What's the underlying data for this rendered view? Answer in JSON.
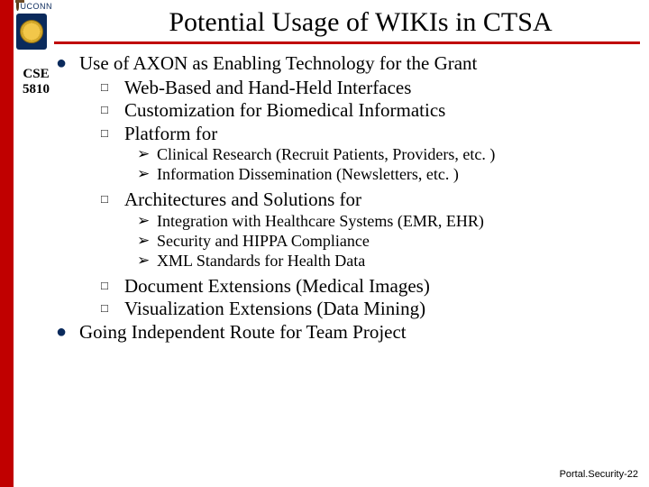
{
  "header": {
    "university_word": "UCONN",
    "course_line1": "CSE",
    "course_line2": "5810",
    "title": "Potential Usage of WIKIs in CTSA"
  },
  "bullets": {
    "b1": "Use of AXON as Enabling Technology for the Grant",
    "b1_1": "Web-Based and Hand-Held Interfaces",
    "b1_2": "Customization for Biomedical Informatics",
    "b1_3": "Platform for",
    "b1_3_a": "Clinical Research (Recruit Patients, Providers, etc. )",
    "b1_3_b": "Information Dissemination (Newsletters, etc. )",
    "b1_4": "Architectures and Solutions for",
    "b1_4_a": "Integration with Healthcare Systems (EMR, EHR)",
    "b1_4_b": "Security and HIPPA Compliance",
    "b1_4_c": "XML Standards for Health Data",
    "b1_5": "Document Extensions (Medical Images)",
    "b1_6": "Visualization Extensions (Data Mining)",
    "b2": "Going Independent Route for Team Project"
  },
  "glyphs": {
    "circle": "●",
    "square": "□",
    "arrow": "➢"
  },
  "footer": "Portal.Security-22"
}
